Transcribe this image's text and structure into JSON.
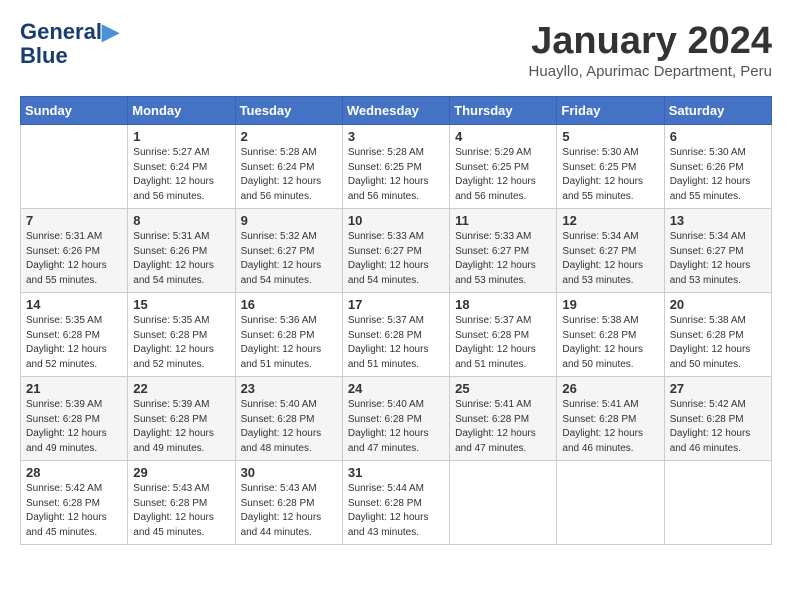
{
  "logo": {
    "line1": "General",
    "line2": "Blue"
  },
  "title": "January 2024",
  "subtitle": "Huayllo, Apurimac Department, Peru",
  "weekdays": [
    "Sunday",
    "Monday",
    "Tuesday",
    "Wednesday",
    "Thursday",
    "Friday",
    "Saturday"
  ],
  "weeks": [
    [
      {
        "day": "",
        "sunrise": "",
        "sunset": "",
        "daylight": ""
      },
      {
        "day": "1",
        "sunrise": "Sunrise: 5:27 AM",
        "sunset": "Sunset: 6:24 PM",
        "daylight": "Daylight: 12 hours and 56 minutes."
      },
      {
        "day": "2",
        "sunrise": "Sunrise: 5:28 AM",
        "sunset": "Sunset: 6:24 PM",
        "daylight": "Daylight: 12 hours and 56 minutes."
      },
      {
        "day": "3",
        "sunrise": "Sunrise: 5:28 AM",
        "sunset": "Sunset: 6:25 PM",
        "daylight": "Daylight: 12 hours and 56 minutes."
      },
      {
        "day": "4",
        "sunrise": "Sunrise: 5:29 AM",
        "sunset": "Sunset: 6:25 PM",
        "daylight": "Daylight: 12 hours and 56 minutes."
      },
      {
        "day": "5",
        "sunrise": "Sunrise: 5:30 AM",
        "sunset": "Sunset: 6:25 PM",
        "daylight": "Daylight: 12 hours and 55 minutes."
      },
      {
        "day": "6",
        "sunrise": "Sunrise: 5:30 AM",
        "sunset": "Sunset: 6:26 PM",
        "daylight": "Daylight: 12 hours and 55 minutes."
      }
    ],
    [
      {
        "day": "7",
        "sunrise": "Sunrise: 5:31 AM",
        "sunset": "Sunset: 6:26 PM",
        "daylight": "Daylight: 12 hours and 55 minutes."
      },
      {
        "day": "8",
        "sunrise": "Sunrise: 5:31 AM",
        "sunset": "Sunset: 6:26 PM",
        "daylight": "Daylight: 12 hours and 54 minutes."
      },
      {
        "day": "9",
        "sunrise": "Sunrise: 5:32 AM",
        "sunset": "Sunset: 6:27 PM",
        "daylight": "Daylight: 12 hours and 54 minutes."
      },
      {
        "day": "10",
        "sunrise": "Sunrise: 5:33 AM",
        "sunset": "Sunset: 6:27 PM",
        "daylight": "Daylight: 12 hours and 54 minutes."
      },
      {
        "day": "11",
        "sunrise": "Sunrise: 5:33 AM",
        "sunset": "Sunset: 6:27 PM",
        "daylight": "Daylight: 12 hours and 53 minutes."
      },
      {
        "day": "12",
        "sunrise": "Sunrise: 5:34 AM",
        "sunset": "Sunset: 6:27 PM",
        "daylight": "Daylight: 12 hours and 53 minutes."
      },
      {
        "day": "13",
        "sunrise": "Sunrise: 5:34 AM",
        "sunset": "Sunset: 6:27 PM",
        "daylight": "Daylight: 12 hours and 53 minutes."
      }
    ],
    [
      {
        "day": "14",
        "sunrise": "Sunrise: 5:35 AM",
        "sunset": "Sunset: 6:28 PM",
        "daylight": "Daylight: 12 hours and 52 minutes."
      },
      {
        "day": "15",
        "sunrise": "Sunrise: 5:35 AM",
        "sunset": "Sunset: 6:28 PM",
        "daylight": "Daylight: 12 hours and 52 minutes."
      },
      {
        "day": "16",
        "sunrise": "Sunrise: 5:36 AM",
        "sunset": "Sunset: 6:28 PM",
        "daylight": "Daylight: 12 hours and 51 minutes."
      },
      {
        "day": "17",
        "sunrise": "Sunrise: 5:37 AM",
        "sunset": "Sunset: 6:28 PM",
        "daylight": "Daylight: 12 hours and 51 minutes."
      },
      {
        "day": "18",
        "sunrise": "Sunrise: 5:37 AM",
        "sunset": "Sunset: 6:28 PM",
        "daylight": "Daylight: 12 hours and 51 minutes."
      },
      {
        "day": "19",
        "sunrise": "Sunrise: 5:38 AM",
        "sunset": "Sunset: 6:28 PM",
        "daylight": "Daylight: 12 hours and 50 minutes."
      },
      {
        "day": "20",
        "sunrise": "Sunrise: 5:38 AM",
        "sunset": "Sunset: 6:28 PM",
        "daylight": "Daylight: 12 hours and 50 minutes."
      }
    ],
    [
      {
        "day": "21",
        "sunrise": "Sunrise: 5:39 AM",
        "sunset": "Sunset: 6:28 PM",
        "daylight": "Daylight: 12 hours and 49 minutes."
      },
      {
        "day": "22",
        "sunrise": "Sunrise: 5:39 AM",
        "sunset": "Sunset: 6:28 PM",
        "daylight": "Daylight: 12 hours and 49 minutes."
      },
      {
        "day": "23",
        "sunrise": "Sunrise: 5:40 AM",
        "sunset": "Sunset: 6:28 PM",
        "daylight": "Daylight: 12 hours and 48 minutes."
      },
      {
        "day": "24",
        "sunrise": "Sunrise: 5:40 AM",
        "sunset": "Sunset: 6:28 PM",
        "daylight": "Daylight: 12 hours and 47 minutes."
      },
      {
        "day": "25",
        "sunrise": "Sunrise: 5:41 AM",
        "sunset": "Sunset: 6:28 PM",
        "daylight": "Daylight: 12 hours and 47 minutes."
      },
      {
        "day": "26",
        "sunrise": "Sunrise: 5:41 AM",
        "sunset": "Sunset: 6:28 PM",
        "daylight": "Daylight: 12 hours and 46 minutes."
      },
      {
        "day": "27",
        "sunrise": "Sunrise: 5:42 AM",
        "sunset": "Sunset: 6:28 PM",
        "daylight": "Daylight: 12 hours and 46 minutes."
      }
    ],
    [
      {
        "day": "28",
        "sunrise": "Sunrise: 5:42 AM",
        "sunset": "Sunset: 6:28 PM",
        "daylight": "Daylight: 12 hours and 45 minutes."
      },
      {
        "day": "29",
        "sunrise": "Sunrise: 5:43 AM",
        "sunset": "Sunset: 6:28 PM",
        "daylight": "Daylight: 12 hours and 45 minutes."
      },
      {
        "day": "30",
        "sunrise": "Sunrise: 5:43 AM",
        "sunset": "Sunset: 6:28 PM",
        "daylight": "Daylight: 12 hours and 44 minutes."
      },
      {
        "day": "31",
        "sunrise": "Sunrise: 5:44 AM",
        "sunset": "Sunset: 6:28 PM",
        "daylight": "Daylight: 12 hours and 43 minutes."
      },
      {
        "day": "",
        "sunrise": "",
        "sunset": "",
        "daylight": ""
      },
      {
        "day": "",
        "sunrise": "",
        "sunset": "",
        "daylight": ""
      },
      {
        "day": "",
        "sunrise": "",
        "sunset": "",
        "daylight": ""
      }
    ]
  ]
}
